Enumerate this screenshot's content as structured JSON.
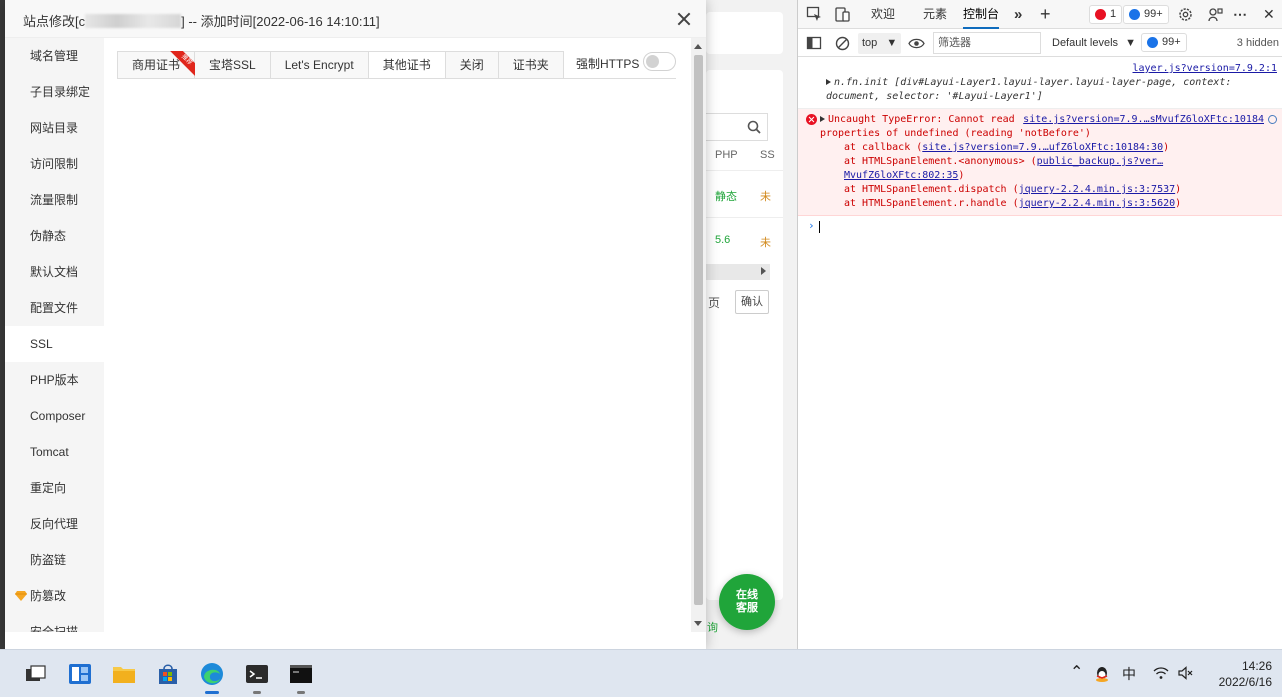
{
  "modal": {
    "title_prefix": "站点修改[c",
    "title_suffix": "] -- 添加时间[2022-06-16 14:10:11]",
    "nav": [
      {
        "label": "域名管理"
      },
      {
        "label": "子目录绑定"
      },
      {
        "label": "网站目录"
      },
      {
        "label": "访问限制"
      },
      {
        "label": "流量限制"
      },
      {
        "label": "伪静态"
      },
      {
        "label": "默认文档"
      },
      {
        "label": "配置文件"
      },
      {
        "label": "SSL"
      },
      {
        "label": "PHP版本"
      },
      {
        "label": "Composer"
      },
      {
        "label": "Tomcat"
      },
      {
        "label": "重定向"
      },
      {
        "label": "反向代理"
      },
      {
        "label": "防盗链"
      },
      {
        "label": "防篡改"
      },
      {
        "label": "安全扫描"
      }
    ],
    "active_nav": "SSL",
    "tabs": [
      {
        "label": "商用证书",
        "ribbon": "推荐"
      },
      {
        "label": "宝塔SSL"
      },
      {
        "label": "Let's Encrypt"
      },
      {
        "label": "其他证书"
      },
      {
        "label": "关闭"
      },
      {
        "label": "证书夹"
      }
    ],
    "active_tab": "其他证书",
    "force_https_label": "强制HTTPS",
    "force_https_enabled": false
  },
  "background": {
    "table_headers": [
      "PHP",
      "SS"
    ],
    "rows": [
      {
        "status": "静态",
        "flag": "未"
      },
      {
        "status": "5.6",
        "flag": "未"
      }
    ],
    "page_label": "页",
    "confirm_button": "确认",
    "footer_link": "询",
    "chat_line1": "在线",
    "chat_line2": "客服",
    "status_color": "#20a53a",
    "warn_color": "#d28a1e"
  },
  "devtools": {
    "tabs": [
      "欢迎",
      "元素",
      "控制台"
    ],
    "active_tab": "控制台",
    "error_count": "1",
    "message_count": "99+",
    "context": "top",
    "filter_placeholder": "筛选器",
    "levels": "Default levels",
    "levels_badge": "99+",
    "hidden_count": "3 hidden",
    "log1": {
      "source": "layer.js?version=7.9.2:1",
      "text": "n.fn.init [div#Layui-Layer1.layui-layer.layui-layer-page, context: document, selector: '#Layui-Layer1']"
    },
    "error": {
      "source": "site.js?version=7.9.…sMvufZ6loXFtc:10184",
      "message": "Uncaught TypeError: Cannot read properties of undefined (reading 'notBefore')",
      "stack": [
        {
          "prefix": "at callback (",
          "link": "site.js?version=7.9.…ufZ6loXFtc:10184:30",
          "suffix": ")"
        },
        {
          "prefix": "at HTMLSpanElement.<anonymous> (",
          "link": "public_backup.js?ver…MvufZ6loXFtc:802:35",
          "suffix": ")"
        },
        {
          "prefix": "at HTMLSpanElement.dispatch (",
          "link": "jquery-2.2.4.min.js:3:7537",
          "suffix": ")"
        },
        {
          "prefix": "at HTMLSpanElement.r.handle (",
          "link": "jquery-2.2.4.min.js:3:5620",
          "suffix": ")"
        }
      ]
    }
  },
  "taskbar": {
    "apps": [
      "task-view-icon",
      "widgets-icon",
      "file-explorer-icon",
      "store-icon",
      "edge-icon",
      "terminal-icon",
      "cmd-icon"
    ],
    "ime": "中",
    "time": "14:26",
    "date": "2022/6/16"
  }
}
